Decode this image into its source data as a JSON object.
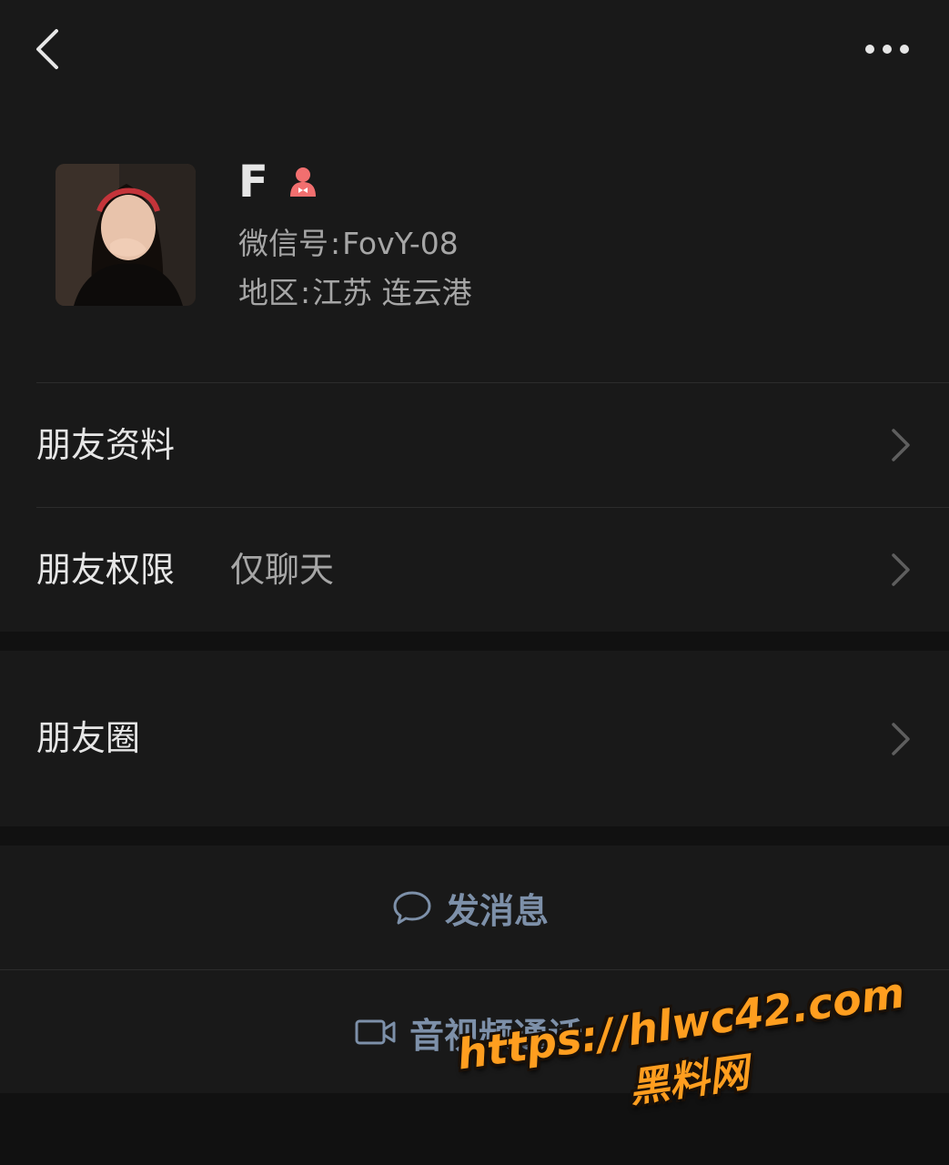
{
  "header": {
    "back_icon": "chevron-left-icon",
    "more_icon": "ellipsis-icon"
  },
  "profile": {
    "avatar_icon": "avatar-photo",
    "name": "F",
    "gender_icon": "female-icon",
    "gender_color": "#f26f6f",
    "wechat_id_label": "微信号",
    "wechat_id_value": "FovY-08",
    "region_label": "地区",
    "region_value": "江苏 连云港"
  },
  "rows": {
    "friend_profile": {
      "label": "朋友资料"
    },
    "friend_permission": {
      "label": "朋友权限",
      "value": "仅聊天"
    },
    "moments": {
      "label": "朋友圈"
    }
  },
  "actions": {
    "message": {
      "label": "发消息",
      "icon": "chat-bubble-icon"
    },
    "call": {
      "label": "音视频通话",
      "icon": "video-camera-icon"
    }
  },
  "watermark": {
    "url": "https://hlwc42.com",
    "text": "黑料网"
  },
  "colors": {
    "background": "#111111",
    "panel": "#191919",
    "primary_text": "#e6e6e6",
    "secondary_text": "#a6a6a6",
    "link_blue": "#7d90a9",
    "watermark_orange": "#ff9e1f"
  }
}
